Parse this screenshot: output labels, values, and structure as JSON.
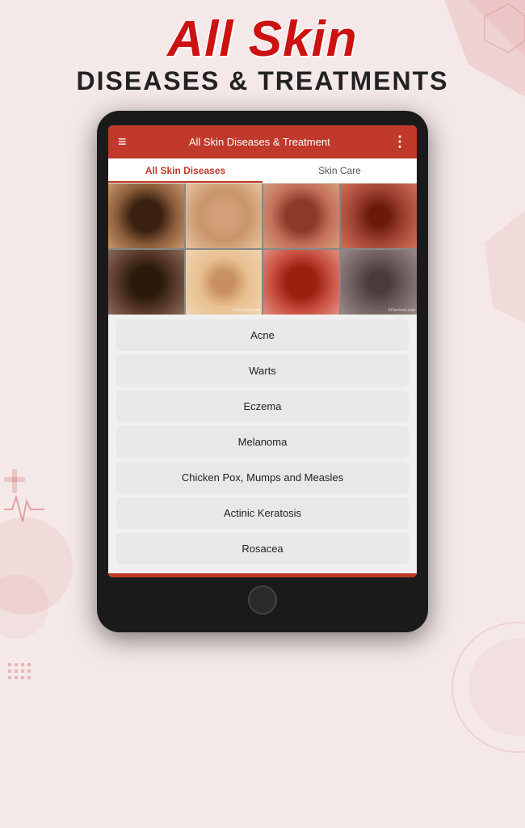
{
  "header": {
    "title_italic": "All Skin",
    "title_main": "DISEASES & TREATMENTS"
  },
  "appbar": {
    "title": "All Skin Diseases & Treatment",
    "hamburger": "≡",
    "more": "⋮"
  },
  "tabs": [
    {
      "label": "All Skin Diseases",
      "active": true
    },
    {
      "label": "Skin Care",
      "active": false
    }
  ],
  "image_grid": [
    {
      "alt": "skin-disease-1",
      "class": "skin-1"
    },
    {
      "alt": "skin-disease-2",
      "class": "skin-2"
    },
    {
      "alt": "skin-disease-3",
      "class": "skin-3"
    },
    {
      "alt": "skin-disease-4",
      "class": "skin-4"
    },
    {
      "alt": "skin-disease-5",
      "class": "skin-5"
    },
    {
      "alt": "skin-disease-6",
      "class": "skin-6"
    },
    {
      "alt": "skin-disease-7",
      "class": "skin-7"
    },
    {
      "alt": "skin-disease-8",
      "class": "skin-8"
    }
  ],
  "diseases": [
    {
      "name": "Acne"
    },
    {
      "name": "Warts"
    },
    {
      "name": "Eczema"
    },
    {
      "name": "Melanoma"
    },
    {
      "name": "Chicken Pox, Mumps and Measles"
    },
    {
      "name": "Actinic Keratosis"
    },
    {
      "name": "Rosacea"
    }
  ]
}
